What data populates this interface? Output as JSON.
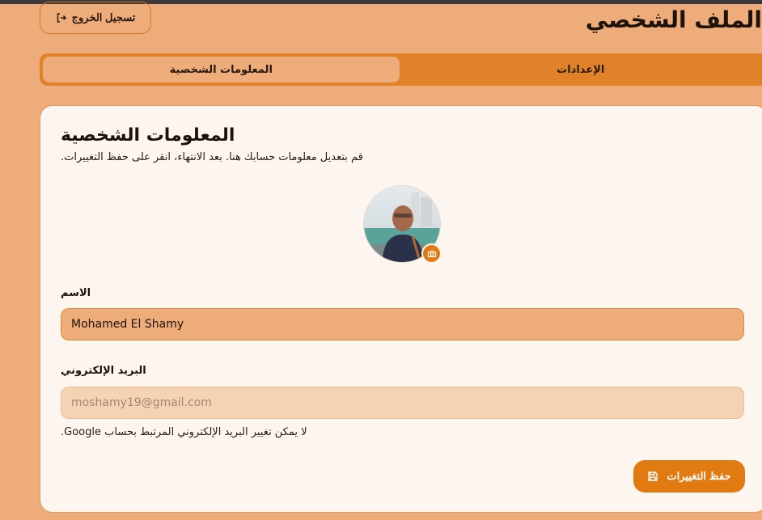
{
  "header": {
    "page_title": "الملف الشخصي",
    "logout_label": "تسجيل الخروج",
    "logout_icon": "logout-icon"
  },
  "tabs": [
    {
      "label": "المعلومات الشخصية",
      "active": true
    },
    {
      "label": "الإعدادات",
      "active": false
    }
  ],
  "card": {
    "title": "المعلومات الشخصية",
    "description": "قم بتعديل معلومات حسابك هنا. بعد الانتهاء، انقر على حفظ التغييرات."
  },
  "avatar": {
    "camera_icon": "camera-icon"
  },
  "form": {
    "name_label": "الاسم",
    "name_value": "Mohamed El Shamy",
    "email_label": "البريد الإلكتروني",
    "email_placeholder": "moshamy19@gmail.com",
    "email_note": "لا يمكن تغيير البريد الإلكتروني المرتبط بحساب Google."
  },
  "actions": {
    "save_label": "حفظ التغييرات",
    "save_icon": "save-icon"
  },
  "colors": {
    "page_bg": "#edac79",
    "accent": "#e27a12",
    "tab_bar": "#e0822a",
    "card_bg": "#fdf6f0"
  }
}
